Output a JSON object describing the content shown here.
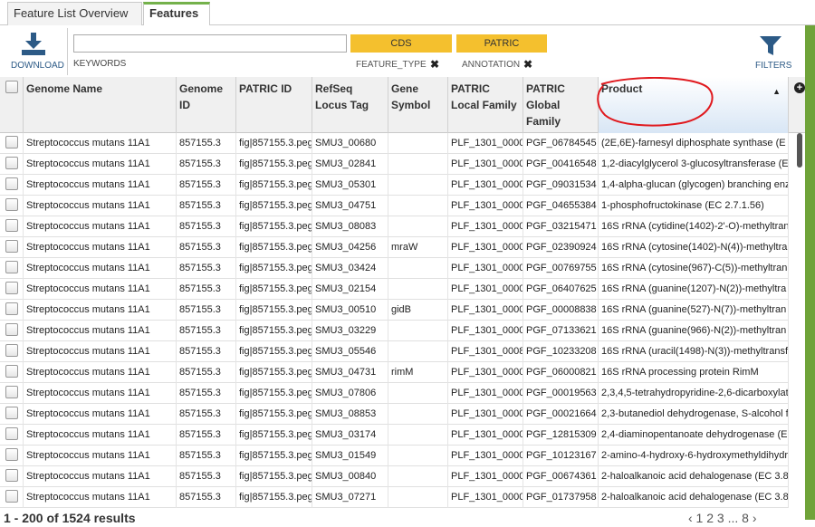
{
  "tabs": [
    {
      "label": "Feature List Overview",
      "active": false
    },
    {
      "label": "Features",
      "active": true
    }
  ],
  "toolbar": {
    "download_label": "DOWNLOAD",
    "keywords_label": "KEYWORDS",
    "keywords_value": "",
    "filter_chips": [
      {
        "value": "CDS",
        "label": "FEATURE_TYPE"
      },
      {
        "value": "PATRIC",
        "label": "ANNOTATION"
      }
    ],
    "remove_glyph": "✖",
    "filters_label": "FILTERS"
  },
  "colors": {
    "chip": "#f4c02e",
    "accent_green": "#6fa339",
    "link_blue": "#2c5a86"
  },
  "columns": [
    "Genome Name",
    "Genome ID",
    "PATRIC ID",
    "RefSeq Locus Tag",
    "Gene Symbol",
    "PATRIC Local Family",
    "PATRIC Global Family",
    "Product"
  ],
  "sort_arrow": "▲",
  "plus_glyph": "+",
  "rows": [
    [
      "Streptococcus mutans 11A1",
      "857155.3",
      "fig|857155.3.peg",
      "SMU3_00680",
      "",
      "PLF_1301_0000",
      "PGF_06784545",
      "(2E,6E)-farnesyl diphosphate synthase (E"
    ],
    [
      "Streptococcus mutans 11A1",
      "857155.3",
      "fig|857155.3.peg",
      "SMU3_02841",
      "",
      "PLF_1301_0000",
      "PGF_00416548",
      "1,2-diacylglycerol 3-glucosyltransferase (E"
    ],
    [
      "Streptococcus mutans 11A1",
      "857155.3",
      "fig|857155.3.peg",
      "SMU3_05301",
      "",
      "PLF_1301_0000",
      "PGF_09031534",
      "1,4-alpha-glucan (glycogen) branching enz"
    ],
    [
      "Streptococcus mutans 11A1",
      "857155.3",
      "fig|857155.3.peg",
      "SMU3_04751",
      "",
      "PLF_1301_0000",
      "PGF_04655384",
      "1-phosphofructokinase (EC 2.7.1.56)"
    ],
    [
      "Streptococcus mutans 11A1",
      "857155.3",
      "fig|857155.3.peg",
      "SMU3_08083",
      "",
      "PLF_1301_0000",
      "PGF_03215471",
      "16S rRNA (cytidine(1402)-2'-O)-methyltran"
    ],
    [
      "Streptococcus mutans 11A1",
      "857155.3",
      "fig|857155.3.peg",
      "SMU3_04256",
      "mraW",
      "PLF_1301_0000",
      "PGF_02390924",
      "16S rRNA (cytosine(1402)-N(4))-methyltra"
    ],
    [
      "Streptococcus mutans 11A1",
      "857155.3",
      "fig|857155.3.peg",
      "SMU3_03424",
      "",
      "PLF_1301_0000",
      "PGF_00769755",
      "16S rRNA (cytosine(967)-C(5))-methyltran"
    ],
    [
      "Streptococcus mutans 11A1",
      "857155.3",
      "fig|857155.3.peg",
      "SMU3_02154",
      "",
      "PLF_1301_0000",
      "PGF_06407625",
      "16S rRNA (guanine(1207)-N(2))-methyltra"
    ],
    [
      "Streptococcus mutans 11A1",
      "857155.3",
      "fig|857155.3.peg",
      "SMU3_00510",
      "gidB",
      "PLF_1301_0000",
      "PGF_00008838",
      "16S rRNA (guanine(527)-N(7))-methyltran"
    ],
    [
      "Streptococcus mutans 11A1",
      "857155.3",
      "fig|857155.3.peg",
      "SMU3_03229",
      "",
      "PLF_1301_0000",
      "PGF_07133621",
      "16S rRNA (guanine(966)-N(2))-methyltran"
    ],
    [
      "Streptococcus mutans 11A1",
      "857155.3",
      "fig|857155.3.peg",
      "SMU3_05546",
      "",
      "PLF_1301_0008",
      "PGF_10233208",
      "16S rRNA (uracil(1498)-N(3))-methyltransf"
    ],
    [
      "Streptococcus mutans 11A1",
      "857155.3",
      "fig|857155.3.peg",
      "SMU3_04731",
      "rimM",
      "PLF_1301_0000",
      "PGF_06000821",
      "16S rRNA processing protein RimM"
    ],
    [
      "Streptococcus mutans 11A1",
      "857155.3",
      "fig|857155.3.peg",
      "SMU3_07806",
      "",
      "PLF_1301_0000",
      "PGF_00019563",
      "2,3,4,5-tetrahydropyridine-2,6-dicarboxylat"
    ],
    [
      "Streptococcus mutans 11A1",
      "857155.3",
      "fig|857155.3.peg",
      "SMU3_08853",
      "",
      "PLF_1301_0000",
      "PGF_00021664",
      "2,3-butanediol dehydrogenase, S-alcohol f"
    ],
    [
      "Streptococcus mutans 11A1",
      "857155.3",
      "fig|857155.3.peg",
      "SMU3_03174",
      "",
      "PLF_1301_0000",
      "PGF_12815309",
      "2,4-diaminopentanoate dehydrogenase (E"
    ],
    [
      "Streptococcus mutans 11A1",
      "857155.3",
      "fig|857155.3.peg",
      "SMU3_01549",
      "",
      "PLF_1301_0000",
      "PGF_10123167",
      "2-amino-4-hydroxy-6-hydroxymethyldihydr"
    ],
    [
      "Streptococcus mutans 11A1",
      "857155.3",
      "fig|857155.3.peg",
      "SMU3_00840",
      "",
      "PLF_1301_0000",
      "PGF_00674361",
      "2-haloalkanoic acid dehalogenase (EC 3.8"
    ],
    [
      "Streptococcus mutans 11A1",
      "857155.3",
      "fig|857155.3.peg",
      "SMU3_07271",
      "",
      "PLF_1301_0000",
      "PGF_01737958",
      "2-haloalkanoic acid dehalogenase (EC 3.8"
    ]
  ],
  "footer": {
    "results": "1 - 200 of 1524 results",
    "pager": "‹ 1   2   3  ...  8   ›"
  }
}
